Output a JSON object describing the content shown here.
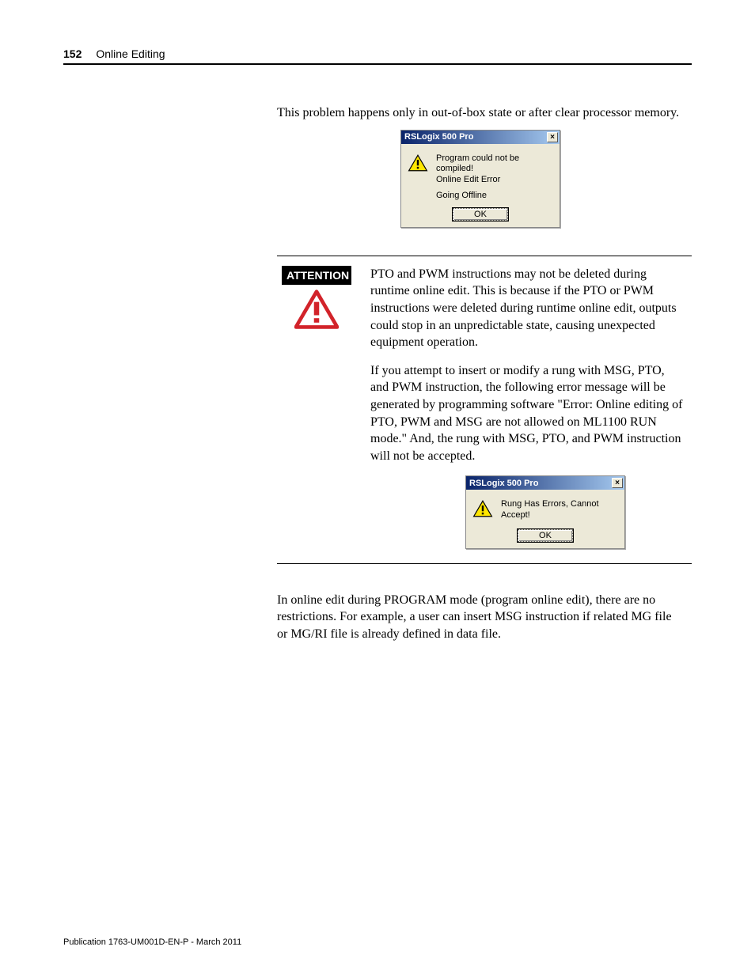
{
  "header": {
    "page_number": "152",
    "section": "Online Editing"
  },
  "intro": "This problem happens only in out-of-box state or after clear processor memory.",
  "dialog1": {
    "title": "RSLogix 500 Pro",
    "close": "×",
    "line1": "Program could not be compiled!",
    "line2": "Online Edit Error",
    "line3": "Going Offline",
    "button": "OK"
  },
  "attention": {
    "label": "ATTENTION",
    "p1": "PTO and PWM instructions may not be deleted during runtime online edit. This is because if the PTO or PWM instructions were deleted during runtime online edit, outputs could stop in an unpredictable state, causing unexpected equipment operation.",
    "p2": "If you attempt to insert or modify a rung with MSG, PTO, and PWM instruction, the following error message will be generated by programming software \"Error: Online editing of PTO, PWM and MSG are not allowed on ML1100 RUN mode.\" And, the rung with MSG, PTO, and PWM instruction will not be accepted."
  },
  "dialog2": {
    "title": "RSLogix 500 Pro",
    "close": "×",
    "msg": "Rung Has Errors, Cannot Accept!",
    "button": "OK"
  },
  "outro": "In online edit during PROGRAM mode (program online edit), there are no restrictions. For example, a user can insert MSG instruction if related MG file or MG/RI file is already defined in data file.",
  "footer": "Publication 1763-UM001D-EN-P - March 2011"
}
